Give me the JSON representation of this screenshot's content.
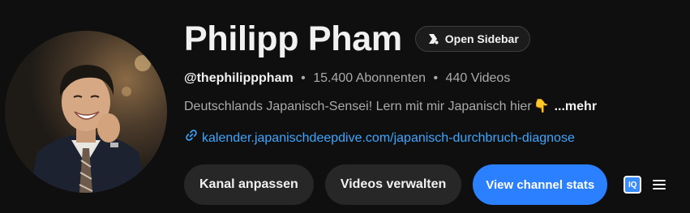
{
  "channel": {
    "name": "Philipp Pham",
    "handle": "@thephilipppham",
    "subscribers": "15.400 Abonnenten",
    "videos": "440 Videos",
    "separator": "•",
    "description": "Deutschlands Japanisch-Sensei! Lern mit mir Japanisch hier",
    "description_emoji": "👇",
    "more_label": "...mehr",
    "link": "kalender.japanischdeepdive.com/japanisch-durchbruch-diagnose"
  },
  "sidebar_button": {
    "label": "Open Sidebar",
    "icon": "sidebar-logo-icon"
  },
  "actions": {
    "customize_label": "Kanal anpassen",
    "manage_label": "Videos verwalten",
    "stats_label": "View channel stats",
    "iq_label": "IQ",
    "menu_icon": "hamburger-menu-icon"
  },
  "colors": {
    "background": "#0f0f0f",
    "link": "#3ea6ff",
    "primary_button": "#2b80ff",
    "secondary_button": "#272727",
    "muted_text": "#aaaaaa"
  }
}
